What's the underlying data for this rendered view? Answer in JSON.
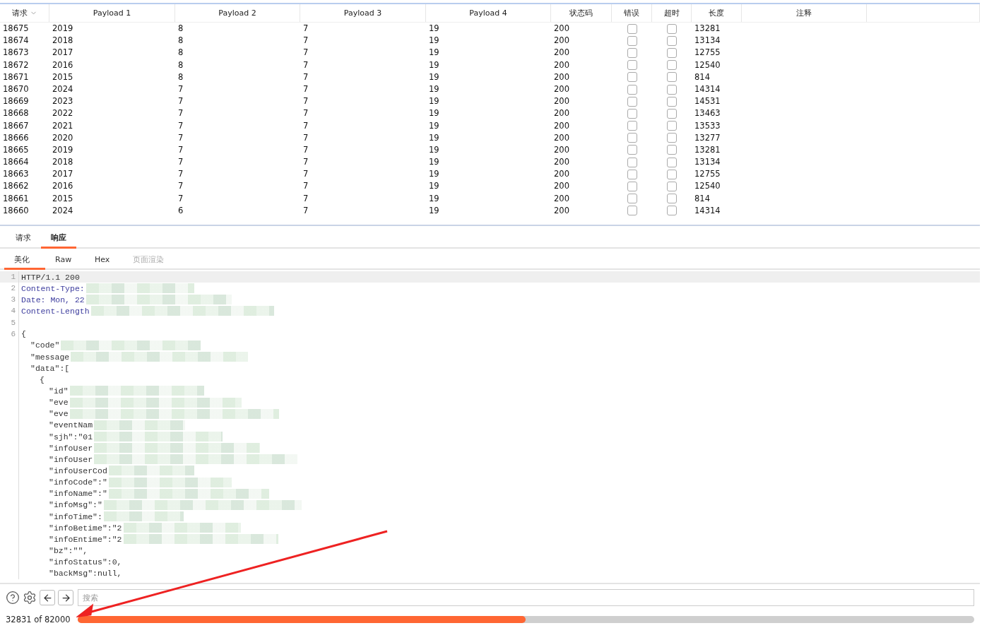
{
  "table": {
    "columns": [
      {
        "label": "请求",
        "sorted": true
      },
      {
        "label": "Payload 1",
        "sorted": false
      },
      {
        "label": "Payload 2",
        "sorted": false
      },
      {
        "label": "Payload 3",
        "sorted": false
      },
      {
        "label": "Payload 4",
        "sorted": false
      },
      {
        "label": "状态码",
        "sorted": false
      },
      {
        "label": "错误",
        "sorted": false
      },
      {
        "label": "超时",
        "sorted": false
      },
      {
        "label": "长度",
        "sorted": false
      },
      {
        "label": "注释",
        "sorted": false
      }
    ],
    "rows": [
      {
        "request": "18675",
        "p1": "2019",
        "p2": "8",
        "p3": "7",
        "p4": "19",
        "status": "200",
        "error": false,
        "timeout": false,
        "length": "13281"
      },
      {
        "request": "18674",
        "p1": "2018",
        "p2": "8",
        "p3": "7",
        "p4": "19",
        "status": "200",
        "error": false,
        "timeout": false,
        "length": "13134"
      },
      {
        "request": "18673",
        "p1": "2017",
        "p2": "8",
        "p3": "7",
        "p4": "19",
        "status": "200",
        "error": false,
        "timeout": false,
        "length": "12755"
      },
      {
        "request": "18672",
        "p1": "2016",
        "p2": "8",
        "p3": "7",
        "p4": "19",
        "status": "200",
        "error": false,
        "timeout": false,
        "length": "12540"
      },
      {
        "request": "18671",
        "p1": "2015",
        "p2": "8",
        "p3": "7",
        "p4": "19",
        "status": "200",
        "error": false,
        "timeout": false,
        "length": "814"
      },
      {
        "request": "18670",
        "p1": "2024",
        "p2": "7",
        "p3": "7",
        "p4": "19",
        "status": "200",
        "error": false,
        "timeout": false,
        "length": "14314"
      },
      {
        "request": "18669",
        "p1": "2023",
        "p2": "7",
        "p3": "7",
        "p4": "19",
        "status": "200",
        "error": false,
        "timeout": false,
        "length": "14531"
      },
      {
        "request": "18668",
        "p1": "2022",
        "p2": "7",
        "p3": "7",
        "p4": "19",
        "status": "200",
        "error": false,
        "timeout": false,
        "length": "13463"
      },
      {
        "request": "18667",
        "p1": "2021",
        "p2": "7",
        "p3": "7",
        "p4": "19",
        "status": "200",
        "error": false,
        "timeout": false,
        "length": "13533"
      },
      {
        "request": "18666",
        "p1": "2020",
        "p2": "7",
        "p3": "7",
        "p4": "19",
        "status": "200",
        "error": false,
        "timeout": false,
        "length": "13277"
      },
      {
        "request": "18665",
        "p1": "2019",
        "p2": "7",
        "p3": "7",
        "p4": "19",
        "status": "200",
        "error": false,
        "timeout": false,
        "length": "13281"
      },
      {
        "request": "18664",
        "p1": "2018",
        "p2": "7",
        "p3": "7",
        "p4": "19",
        "status": "200",
        "error": false,
        "timeout": false,
        "length": "13134"
      },
      {
        "request": "18663",
        "p1": "2017",
        "p2": "7",
        "p3": "7",
        "p4": "19",
        "status": "200",
        "error": false,
        "timeout": false,
        "length": "12755"
      },
      {
        "request": "18662",
        "p1": "2016",
        "p2": "7",
        "p3": "7",
        "p4": "19",
        "status": "200",
        "error": false,
        "timeout": false,
        "length": "12540"
      },
      {
        "request": "18661",
        "p1": "2015",
        "p2": "7",
        "p3": "7",
        "p4": "19",
        "status": "200",
        "error": false,
        "timeout": false,
        "length": "814"
      },
      {
        "request": "18660",
        "p1": "2024",
        "p2": "6",
        "p3": "7",
        "p4": "19",
        "status": "200",
        "error": false,
        "timeout": false,
        "length": "14314"
      }
    ]
  },
  "tabs": [
    {
      "label": "请求",
      "selected": false
    },
    {
      "label": "响应",
      "selected": true
    }
  ],
  "view_tabs": [
    {
      "label": "美化",
      "selected": true,
      "disabled": false
    },
    {
      "label": "Raw",
      "selected": false,
      "disabled": false
    },
    {
      "label": "Hex",
      "selected": false,
      "disabled": false
    },
    {
      "label": "页面渲染",
      "selected": false,
      "disabled": true
    }
  ],
  "editor": {
    "lines": [
      {
        "number": "1",
        "kind": "status",
        "text": "HTTP/1.1 200",
        "redacted": false,
        "highlighted": true
      },
      {
        "number": "2",
        "kind": "header",
        "text": "Content-Type:",
        "redacted": true,
        "highlighted": false
      },
      {
        "number": "3",
        "kind": "header",
        "text": "Date: Mon, 22",
        "redacted": true,
        "highlighted": false
      },
      {
        "number": "4",
        "kind": "header",
        "text": "Content-Length",
        "redacted": true,
        "highlighted": false
      },
      {
        "number": "5",
        "redacted": false,
        "highlighted": false
      },
      {
        "number": "6",
        "kind": "plain",
        "text": "{",
        "redacted": false,
        "highlighted": false,
        "children": [
          {
            "text": "\"code\"",
            "redacted": true,
            "highlighted": false
          },
          {
            "text": "\"message",
            "redacted": true,
            "highlighted": false
          },
          {
            "text": "\"data\":[",
            "redacted": false,
            "highlighted": false,
            "children": [
              {
                "text": "{",
                "redacted": false,
                "highlighted": false,
                "children": [
                  {
                    "text": "\"id\"",
                    "redacted": true,
                    "highlighted": false
                  },
                  {
                    "text": "\"eve",
                    "redacted": true,
                    "highlighted": false
                  },
                  {
                    "text": "\"eve",
                    "redacted": true,
                    "highlighted": false
                  },
                  {
                    "text": "\"eventNam",
                    "redacted": true,
                    "highlighted": false
                  },
                  {
                    "text": "\"sjh\":\"01",
                    "redacted": true,
                    "highlighted": false
                  },
                  {
                    "text": "\"infoUser",
                    "redacted": true,
                    "highlighted": false
                  },
                  {
                    "text": "\"infoUser",
                    "redacted": true,
                    "highlighted": false
                  },
                  {
                    "text": "\"infoUserCod",
                    "redacted": true,
                    "highlighted": false
                  },
                  {
                    "text": "\"infoCode\":\"",
                    "redacted": true,
                    "highlighted": false
                  },
                  {
                    "text": "\"infoName\":\"",
                    "redacted": true,
                    "highlighted": false
                  },
                  {
                    "text": "\"infoMsg\":\"",
                    "redacted": true,
                    "highlighted": false
                  },
                  {
                    "text": "\"infoTime\":",
                    "redacted": true,
                    "highlighted": false
                  },
                  {
                    "text": "\"infoBetime\":\"2",
                    "redacted": true,
                    "highlighted": false
                  },
                  {
                    "text": "\"infoEntime\":\"2",
                    "redacted": true,
                    "highlighted": false
                  },
                  {
                    "text": "\"bz\":\"\",",
                    "redacted": false,
                    "highlighted": false
                  },
                  {
                    "text": "\"infoStatus\":0,",
                    "redacted": false,
                    "highlighted": false
                  },
                  {
                    "text": "\"backMsg\":null,",
                    "redacted": false,
                    "highlighted": false
                  }
                ]
              }
            ]
          }
        ]
      }
    ]
  },
  "search": {
    "placeholder": "搜索"
  },
  "progress": {
    "text": "32831 of 82000",
    "level": 0.5
  }
}
